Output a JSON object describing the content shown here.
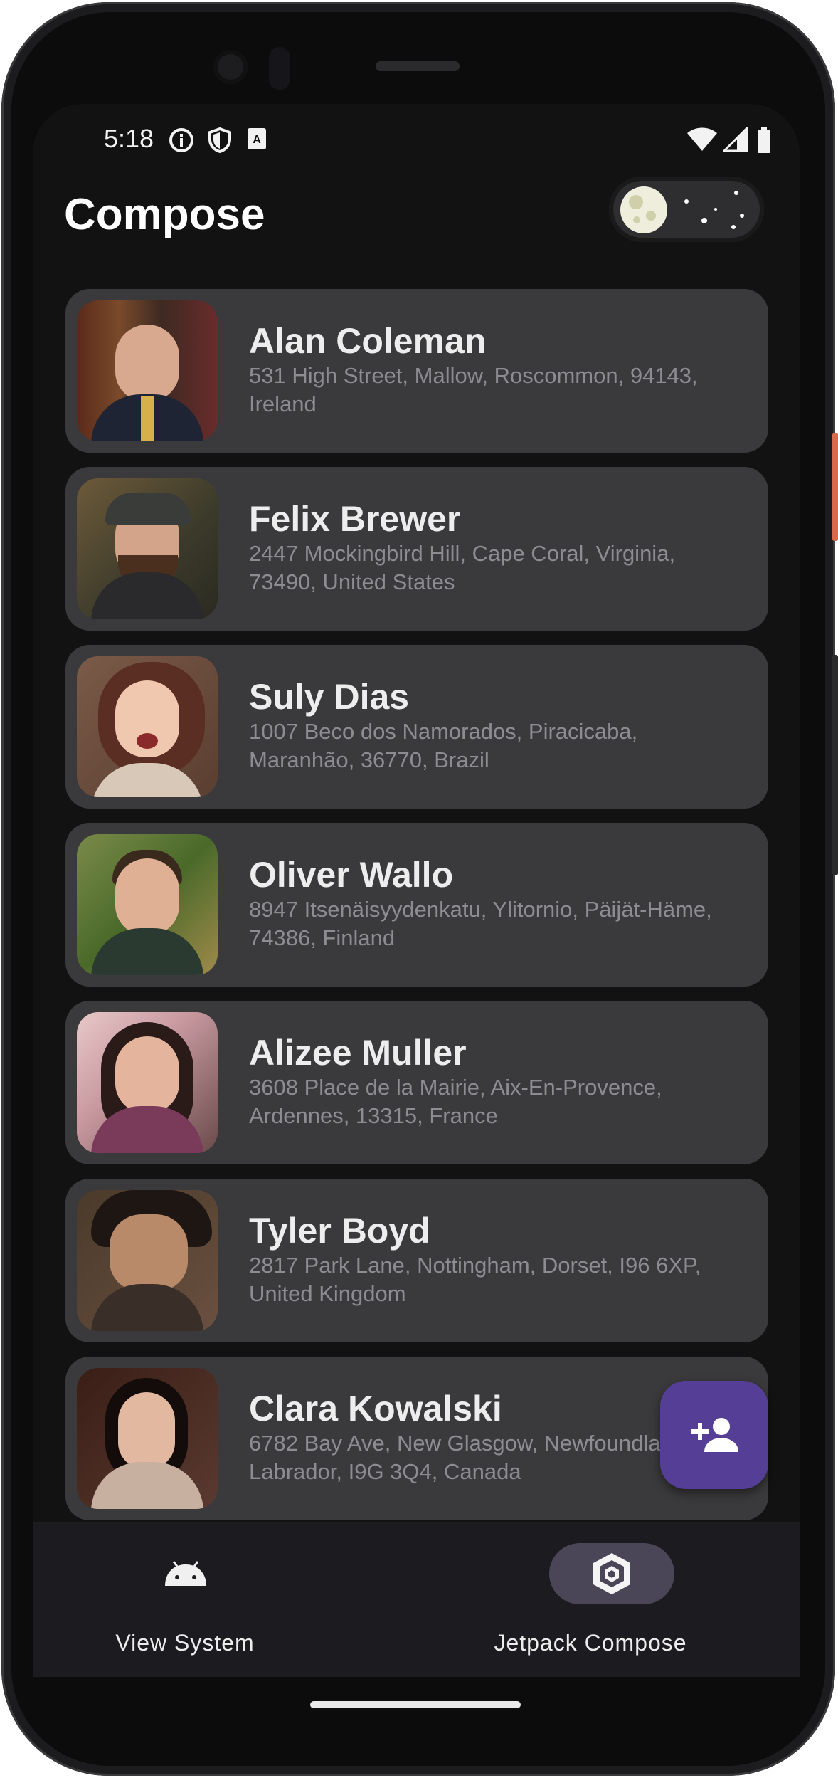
{
  "status_bar": {
    "time": "5:18"
  },
  "app_bar": {
    "title": "Compose",
    "theme_toggle": "dark"
  },
  "contacts": [
    {
      "name": "Alan Coleman",
      "address": "531 High Street, Mallow, Roscommon, 94143, Ireland"
    },
    {
      "name": "Felix Brewer",
      "address": "2447 Mockingbird Hill, Cape Coral, Virginia, 73490, United States"
    },
    {
      "name": "Suly Dias",
      "address": "1007 Beco dos Namorados, Piracicaba, Maranhão, 36770, Brazil"
    },
    {
      "name": "Oliver Wallo",
      "address": "8947 Itsenäisyydenkatu, Ylitornio, Päijät-Häme, 74386, Finland"
    },
    {
      "name": "Alizee Muller",
      "address": "3608 Place de la Mairie, Aix-En-Provence, Ardennes, 13315, France"
    },
    {
      "name": "Tyler Boyd",
      "address": "2817 Park Lane, Nottingham, Dorset, I96 6XP, United Kingdom"
    },
    {
      "name": "Clara Kowalski",
      "address": "6782 Bay Ave, New Glasgow, Newfoundland and Labrador, I9G 3Q4, Canada"
    }
  ],
  "fab": {
    "icon": "add-person-icon"
  },
  "bottom_nav": {
    "items": [
      {
        "label": "View System",
        "icon": "android-icon"
      },
      {
        "label": "Jetpack Compose",
        "icon": "compose-logo-icon"
      }
    ],
    "selected": "Jetpack Compose"
  },
  "colors": {
    "background": "#121212",
    "card": "#3a3a3c",
    "fab": "#553e96",
    "nav_pill": "#4a4658"
  }
}
